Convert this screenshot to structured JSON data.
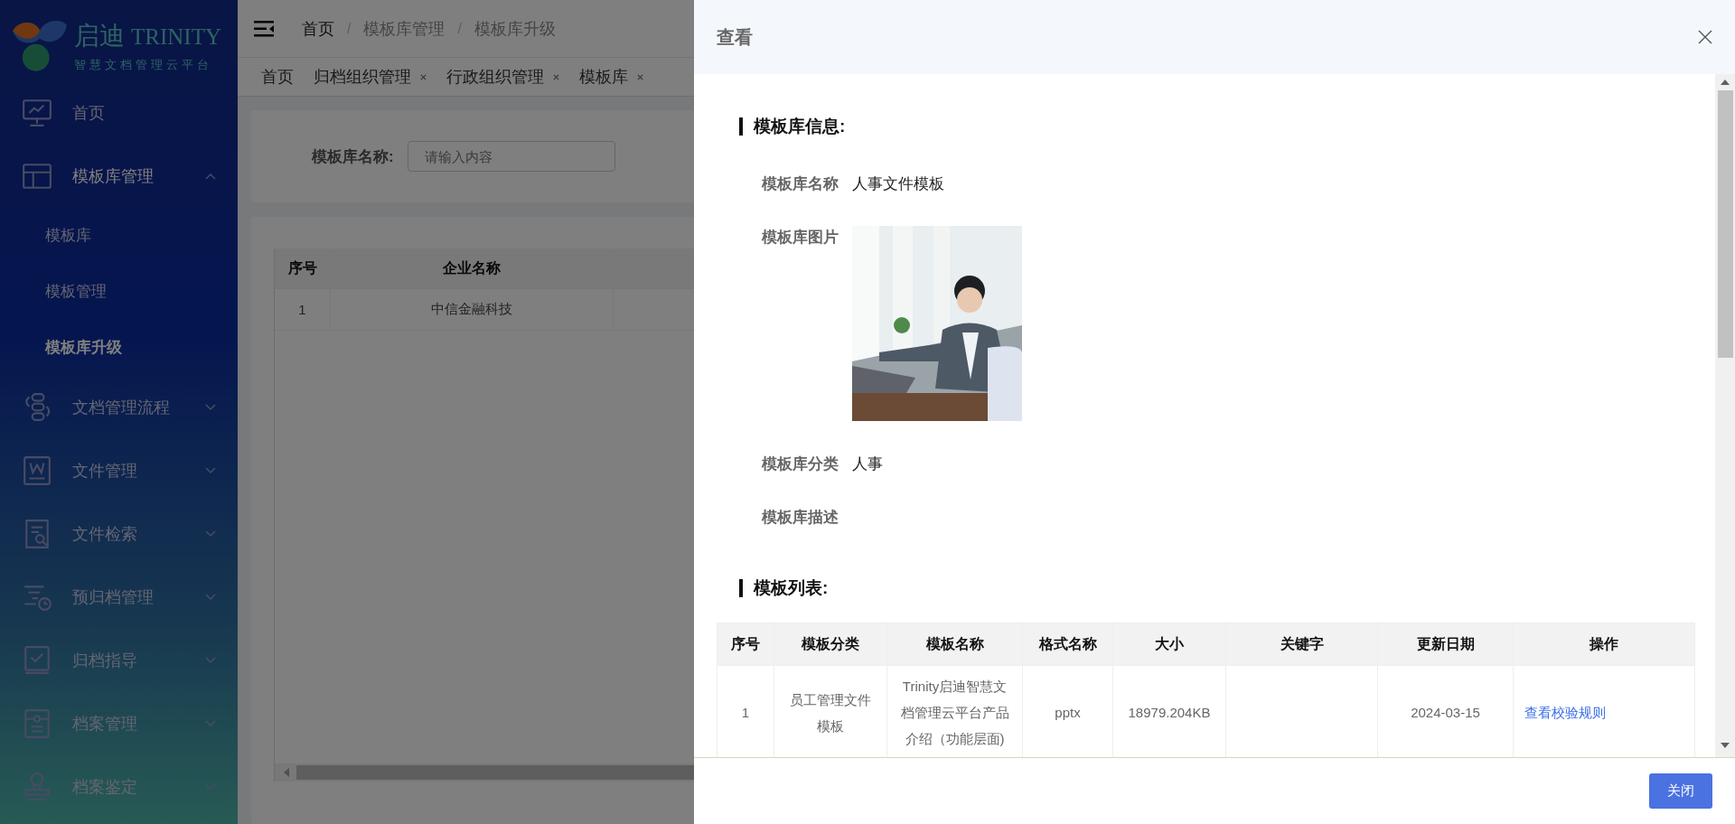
{
  "brand": {
    "name": "启迪",
    "name_latin": "TRINITY",
    "tagline": "智慧文档管理云平台"
  },
  "sidebar": {
    "items": [
      {
        "label": "首页"
      },
      {
        "label": "模板库管理",
        "expanded": true,
        "children": [
          {
            "label": "模板库",
            "selected": false
          },
          {
            "label": "模板管理",
            "selected": false
          },
          {
            "label": "模板库升级",
            "selected": true
          }
        ]
      },
      {
        "label": "文档管理流程",
        "expanded": false
      },
      {
        "label": "文件管理",
        "expanded": false
      },
      {
        "label": "文件检索",
        "expanded": false
      },
      {
        "label": "预归档管理",
        "expanded": false
      },
      {
        "label": "归档指导",
        "expanded": false
      },
      {
        "label": "档案管理",
        "expanded": false
      },
      {
        "label": "档案鉴定",
        "expanded": false
      }
    ]
  },
  "breadcrumb": [
    {
      "label": "首页"
    },
    {
      "separator": "/",
      "label": "模板库管理"
    },
    {
      "separator": "/",
      "label": "模板库升级"
    }
  ],
  "tabs": [
    {
      "label": "首页",
      "closable": false
    },
    {
      "label": "归档组织管理",
      "closable": true
    },
    {
      "label": "行政组织管理",
      "closable": true
    },
    {
      "label": "模板库",
      "closable": true
    }
  ],
  "filter": {
    "label": "模板库名称:",
    "placeholder": "请输入内容"
  },
  "table": {
    "columns": [
      "序号",
      "企业名称"
    ],
    "rows": [
      [
        "1",
        "中信金融科技"
      ]
    ]
  },
  "drawer": {
    "title": "查看",
    "info": {
      "title": "模板库信息:",
      "fields": [
        {
          "label": "模板库名称",
          "kind": "text",
          "value": "人事文件模板"
        },
        {
          "label": "模板库图片",
          "kind": "picture"
        },
        {
          "label": "模板库分类",
          "kind": "text",
          "value": "人事"
        },
        {
          "label": "模板库描述",
          "kind": "text"
        }
      ]
    },
    "list": {
      "title": "模板列表:",
      "columns": [
        "序号",
        "模板分类",
        "模板名称",
        "格式名称",
        "大小",
        "关键字",
        "更新日期",
        "操作"
      ],
      "rows": [
        {
          "cells": [
            "1",
            "员工管理文件模板",
            "Trinity启迪智慧文档管理云平台产品介绍（功能层面)",
            "pptx",
            "18979.204KB",
            "",
            "2024-03-15"
          ],
          "action": "查看校验规则"
        }
      ]
    },
    "buttons": [
      "关闭"
    ]
  }
}
